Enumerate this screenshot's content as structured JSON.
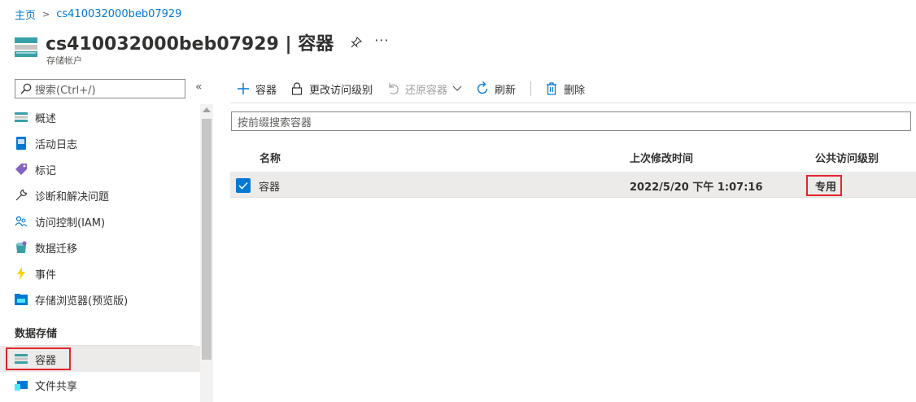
{
  "breadcrumb": {
    "home": "主页",
    "current": "cs410032000beb07929"
  },
  "header": {
    "title": "cs410032000beb07929 | 容器",
    "subtitle": "存储帐户",
    "more": "···"
  },
  "sidebar": {
    "search_placeholder": "搜索(Ctrl+/)",
    "collapse": "«",
    "items": [
      {
        "label": "概述",
        "icon": "overview-icon"
      },
      {
        "label": "活动日志",
        "icon": "activity-log-icon"
      },
      {
        "label": "标记",
        "icon": "tag-icon"
      },
      {
        "label": "诊断和解决问题",
        "icon": "wrench-icon"
      },
      {
        "label": "访问控制(IAM)",
        "icon": "people-icon"
      },
      {
        "label": "数据迁移",
        "icon": "data-migration-icon"
      },
      {
        "label": "事件",
        "icon": "lightning-icon"
      },
      {
        "label": "存储浏览器(预览版)",
        "icon": "storage-explorer-icon"
      }
    ],
    "section_label": "数据存储",
    "section_items": [
      {
        "label": "容器",
        "icon": "container-icon",
        "selected": true
      },
      {
        "label": "文件共享",
        "icon": "file-share-icon"
      }
    ]
  },
  "toolbar": {
    "add": "容器",
    "change_access": "更改访问级别",
    "restore": "还原容器",
    "refresh": "刷新",
    "delete": "删除"
  },
  "filter": {
    "placeholder": "按前缀搜索容器"
  },
  "grid": {
    "columns": [
      "名称",
      "上次修改时间",
      "公共访问级别"
    ],
    "rows": [
      {
        "name": "容器",
        "modified": "2022/5/20 下午 1:07:16",
        "access": "专用",
        "checked": true
      }
    ]
  },
  "colors": {
    "accent": "#0078d4",
    "highlight": "#e3242b",
    "selected_bg": "#edebe9"
  }
}
